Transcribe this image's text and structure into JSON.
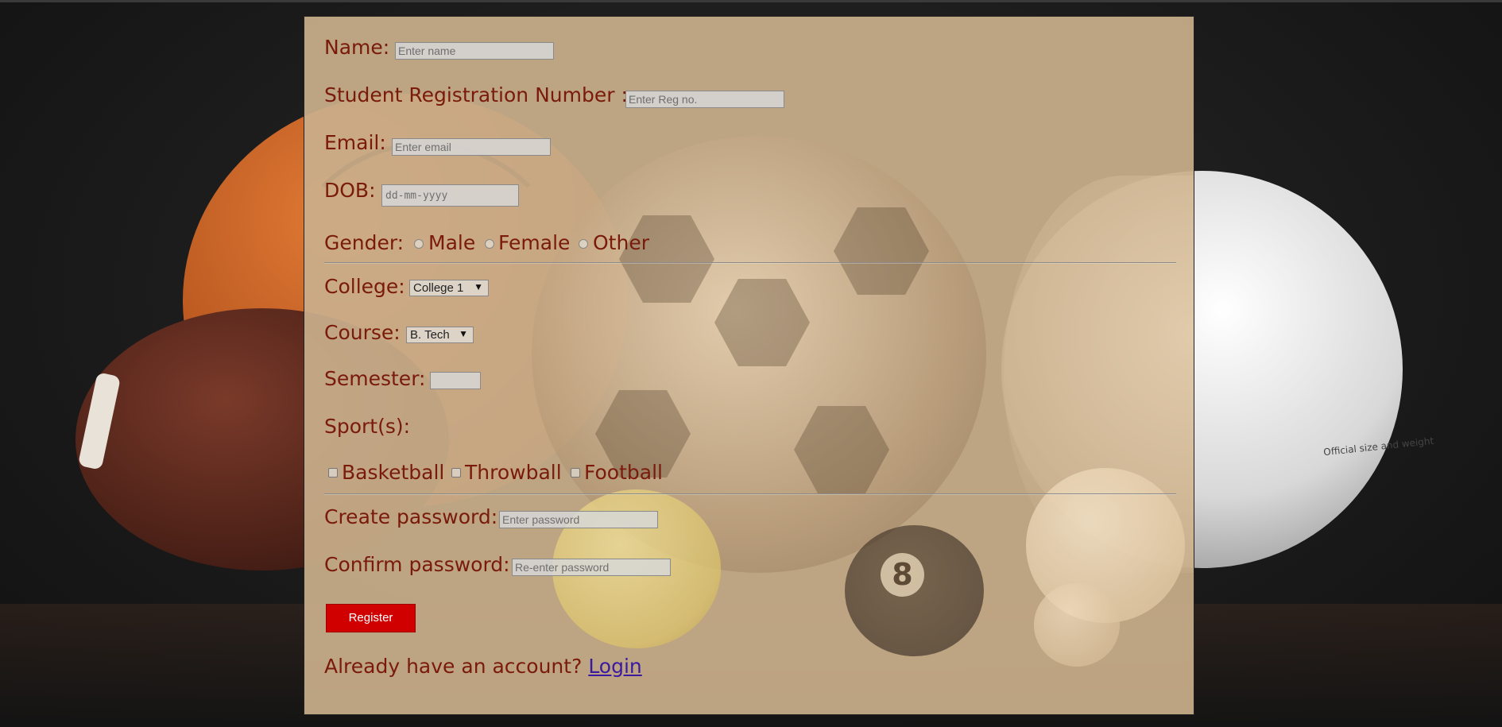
{
  "form": {
    "name": {
      "label": "Name:",
      "placeholder": "Enter name"
    },
    "reg": {
      "label": "Student Registration Number :",
      "placeholder": "Enter Reg no."
    },
    "email": {
      "label": "Email:",
      "placeholder": "Enter email"
    },
    "dob": {
      "label": "DOB:",
      "placeholder": "dd-mm-yyyy"
    },
    "gender": {
      "label": "Gender:",
      "options": [
        "Male",
        "Female",
        "Other"
      ]
    },
    "college": {
      "label": "College:",
      "selected": "College 1"
    },
    "course": {
      "label": "Course:",
      "selected": "B. Tech"
    },
    "semester": {
      "label": "Semester:",
      "value": ""
    },
    "sports": {
      "label": "Sport(s):",
      "options": [
        "Basketball",
        "Throwball",
        "Football"
      ]
    },
    "create_password": {
      "label": "Create password:",
      "placeholder": "Enter password"
    },
    "confirm_password": {
      "label": "Confirm password:",
      "placeholder": "Re-enter password"
    },
    "register_label": "Register",
    "account_prompt": "Already have an account?",
    "login_label": "Login"
  },
  "background": {
    "volleyball_text": "Official size and weight",
    "eight_ball": "8"
  },
  "colors": {
    "panel": "#c9ae8b",
    "label_text": "#7a1a0a",
    "button": "#d00000",
    "link": "#3a1aa0"
  }
}
